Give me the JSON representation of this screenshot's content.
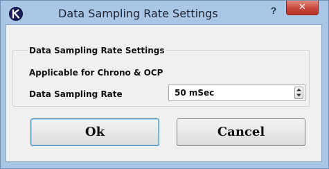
{
  "window": {
    "title": "Data Sampling Rate Settings",
    "app_icon": "k-logo-icon",
    "help_label": "?",
    "close_label": "✕",
    "colors": {
      "titlebar": "#a9c6e6",
      "client": "#f0f0f0",
      "close": "#c7483a"
    }
  },
  "group": {
    "title": "Data Sampling Rate Settings",
    "applicable_text": "Applicable for Chrono & OCP",
    "rate_label": "Data Sampling Rate",
    "rate_value": "50 mSec"
  },
  "buttons": {
    "ok_label": "Ok",
    "cancel_label": "Cancel"
  }
}
